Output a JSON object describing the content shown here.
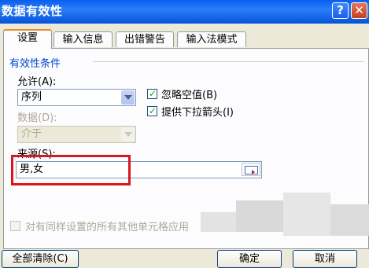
{
  "window": {
    "title": "数据有效性",
    "help_glyph": "?",
    "close_glyph": "✕"
  },
  "tabs": [
    {
      "label": "设置"
    },
    {
      "label": "输入信息"
    },
    {
      "label": "出错警告"
    },
    {
      "label": "输入法模式"
    }
  ],
  "settings": {
    "group_label": "有效性条件",
    "allow_label": "允许(A):",
    "allow_value": "序列",
    "data_label": "数据(D):",
    "data_value": "介于",
    "ignore_blank_label": "忽略空值(B)",
    "dropdown_label": "提供下拉箭头(I)",
    "source_label": "来源(S):",
    "source_value": "男,女",
    "apply_all_label": "对有同样设置的所有其他单元格应用",
    "checkmark": "✓"
  },
  "buttons": {
    "clear_all": "全部清除(C)",
    "ok": "确定",
    "cancel": "取消"
  }
}
